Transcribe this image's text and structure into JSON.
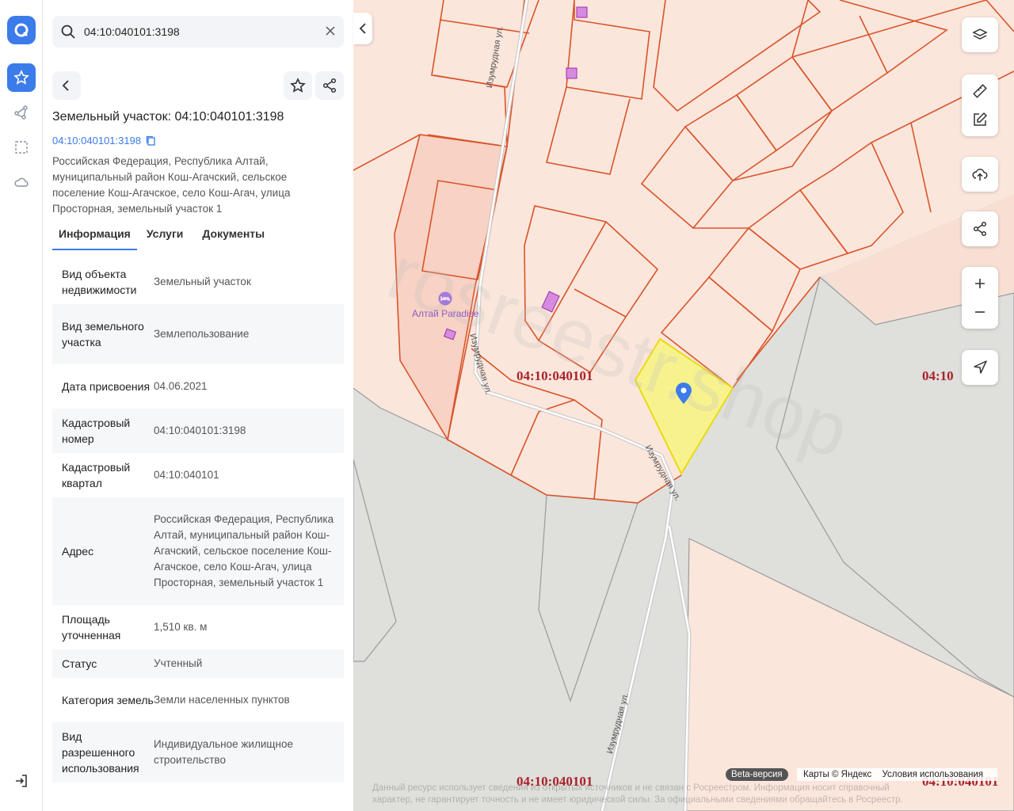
{
  "search": {
    "value": "04:10:040101:3198"
  },
  "card": {
    "title": "Земельный участок: 04:10:040101:3198",
    "cadastral_link": "04:10:040101:3198",
    "address": "Российская Федерация, Республика Алтай, муниципальный район Кош-Агачский, сельское поселение Кош-Агачское, село Кош-Агач, улица Просторная, земельный участок 1"
  },
  "tabs": [
    "Информация",
    "Услуги",
    "Документы"
  ],
  "info_rows": [
    {
      "key": "Вид объекта недвижимости",
      "value": "Земельный участок"
    },
    {
      "key": "Вид земельного участка",
      "value": "Землепользование"
    },
    {
      "key": "Дата присвоения",
      "value": "04.06.2021"
    },
    {
      "key": "Кадастровый номер",
      "value": "04:10:040101:3198"
    },
    {
      "key": "Кадастровый квартал",
      "value": "04:10:040101"
    },
    {
      "key": "Адрес",
      "value": "Российская Федерация, Республика Алтай, муниципальный район Кош-Агачский, сельское поселение Кош-Агачское, село Кош-Агач, улица Просторная, земельный участок 1"
    },
    {
      "key": "Площадь уточненная",
      "value": "1,510 кв. м"
    },
    {
      "key": "Статус",
      "value": "Учтенный"
    },
    {
      "key": "Категория земель",
      "value": "Земли населенных пунктов"
    },
    {
      "key": "Вид разрешенного использования",
      "value": "Индивидуальное жилищное строительство"
    }
  ],
  "map": {
    "quarter_labels": [
      "04:10:040101",
      "04:10",
      "04:10:040101",
      "04:10:040101"
    ],
    "street_label": "Изумрудная ул.",
    "poi_label": "Алтай Paradise",
    "watermark": "rosreestr.shop",
    "beta_badge": "Beta-версия",
    "attribution": "Карты © Яндекс",
    "terms_link": "Условия использования",
    "disclaimer": "Данный ресурс использует сведения из открытых источников и не связан с Росреестром. Информация носит справочный характер, не гарантирует точность и не имеет юридической силы. За официальными сведениями обращайтесь в Росреестр."
  },
  "colors": {
    "accent": "#3b7bea",
    "parcel_border": "#d9542a",
    "parcel_fill": "#fbe6dc",
    "selected_fill": "#f8f28e",
    "quarter_label": "#a8222a"
  },
  "icons": [
    "search-icon",
    "close-icon",
    "back-icon",
    "star-icon",
    "share-icon",
    "copy-icon",
    "layers-icon",
    "ruler-icon",
    "edit-icon",
    "upload-icon",
    "plus-icon",
    "minus-icon",
    "locate-icon",
    "route-icon",
    "select-area-icon",
    "cloud-icon",
    "logout-icon",
    "chevron-left-icon",
    "map-pin-icon",
    "hotel-icon"
  ]
}
